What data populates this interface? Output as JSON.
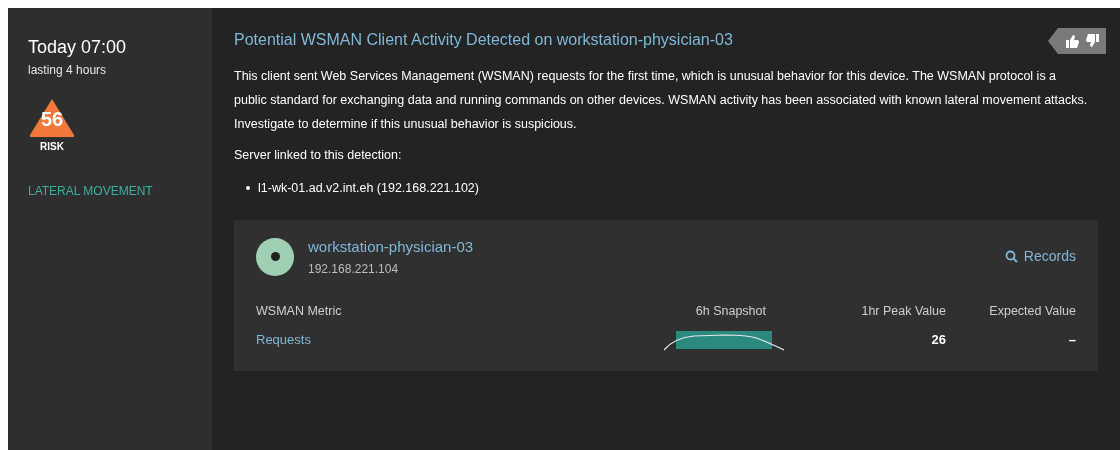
{
  "summary": {
    "time": "Today 07:00",
    "duration": "lasting 4 hours",
    "risk": {
      "score": "56",
      "label": "RISK"
    },
    "category": "LATERAL MOVEMENT"
  },
  "detection": {
    "title": "Potential WSMAN Client Activity Detected on workstation-physician-03",
    "description": "This client sent Web Services Management (WSMAN) requests for the first time, which is unusual behavior for this device. The WSMAN protocol is a public standard for exchanging data and running commands on other devices. WSMAN activity has been associated with known lateral movement attacks. Investigate to determine if this unusual behavior is suspicious.",
    "servers_heading": "Server linked to this detection:",
    "servers": [
      "l1-wk-01.ad.v2.int.eh (192.168.221.102)"
    ]
  },
  "device_card": {
    "name": "workstation-physician-03",
    "ip": "192.168.221.104",
    "records_link": "Records",
    "columns": [
      "WSMAN Metric",
      "6h Snapshot",
      "1hr Peak Value",
      "Expected Value"
    ],
    "rows": [
      {
        "metric": "Requests",
        "peak": "26",
        "expected": "–"
      }
    ]
  }
}
